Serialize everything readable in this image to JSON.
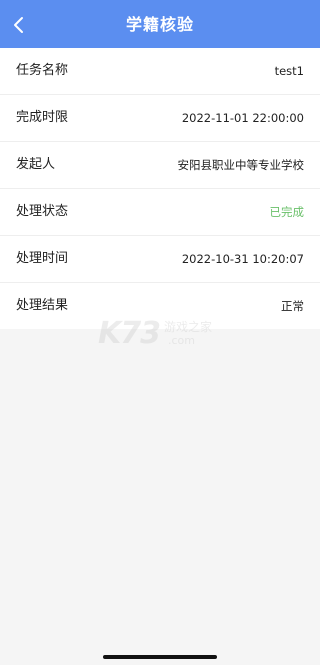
{
  "header": {
    "title": "学籍核验",
    "back_icon": "chevron-left-icon",
    "background_color": "#5b8ef0"
  },
  "rows": [
    {
      "label": "任务名称",
      "value": "test1"
    },
    {
      "label": "完成时限",
      "value": "2022-11-01 22:00:00"
    },
    {
      "label": "发起人",
      "value": "安阳县职业中等专业学校"
    },
    {
      "label": "处理状态",
      "value": "已完成",
      "value_color": "#6ac06a"
    },
    {
      "label": "处理时间",
      "value": "2022-10-31 10:20:07"
    },
    {
      "label": "处理结果",
      "value": "正常"
    }
  ],
  "watermark": {
    "logo": "K73",
    "text": "游戏之家",
    "sub": ".com"
  }
}
